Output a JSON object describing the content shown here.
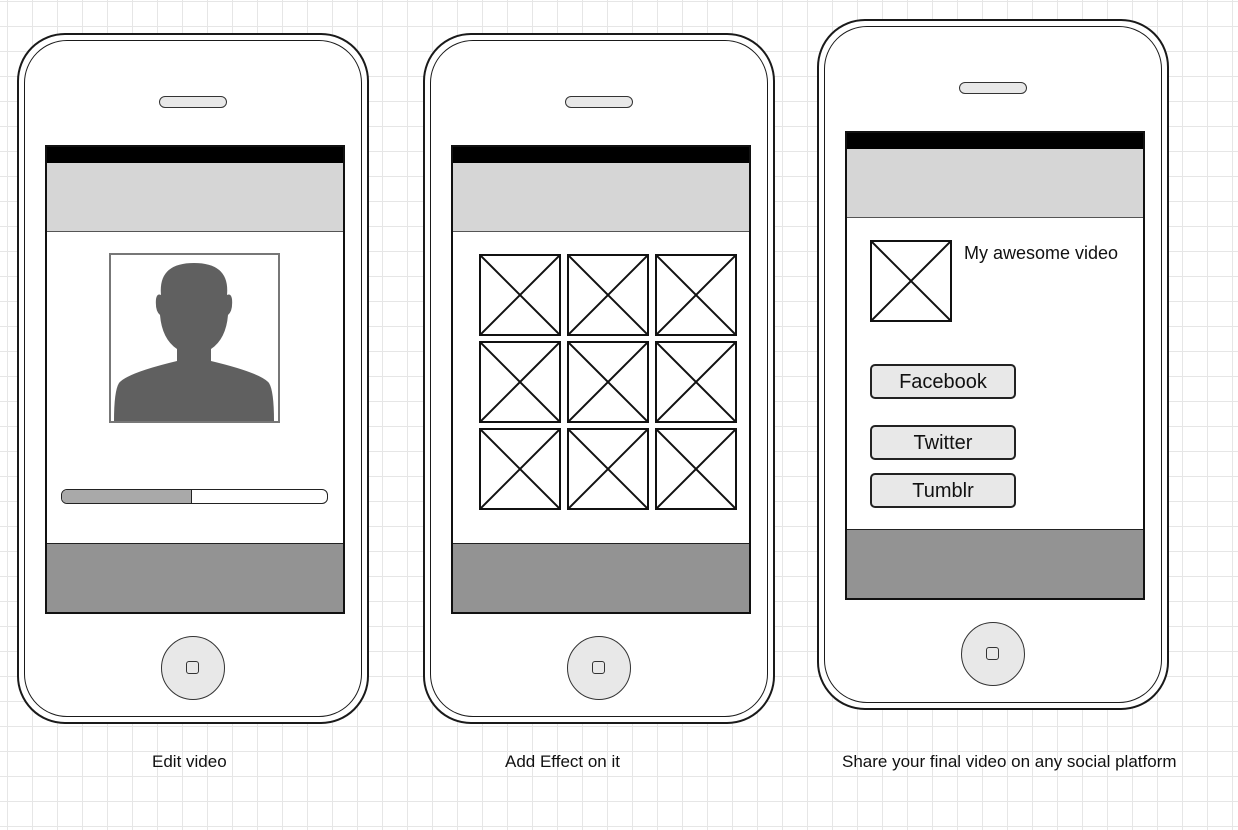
{
  "colors": {
    "status_bar": "#000000",
    "header": "#d6d6d6",
    "footer": "#939393",
    "avatar_silhouette": "#606060",
    "progress_fill": "#a9a9a9",
    "button_fill": "#e8e8e8"
  },
  "screens": [
    {
      "caption": "Edit video",
      "content": {
        "avatar_icon": "user-silhouette-icon",
        "progress_fraction": 0.49
      }
    },
    {
      "caption": "Add Effect on it",
      "content": {
        "grid_rows": 3,
        "grid_cols": 3,
        "thumbnail_icon": "image-placeholder-icon"
      }
    },
    {
      "caption": "Share your final video on any social platform",
      "content": {
        "video_title": "My awesome video",
        "thumbnail_icon": "image-placeholder-icon",
        "share_buttons": [
          {
            "label": "Facebook"
          },
          {
            "label": "Twitter"
          },
          {
            "label": "Tumblr"
          }
        ]
      }
    }
  ]
}
